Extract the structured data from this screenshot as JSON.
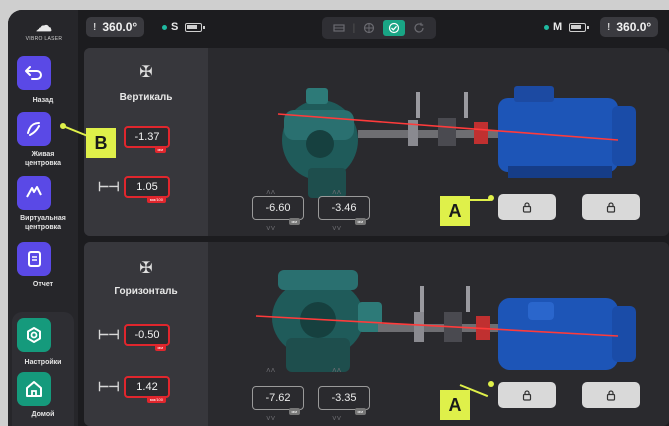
{
  "sidebar": {
    "logo_text": "VIBRO LASER",
    "items": [
      {
        "label": "Назад",
        "icon": "back-arrow-icon"
      },
      {
        "label": "Живая центровка",
        "icon": "live-alignment-icon"
      },
      {
        "label": "Виртуальная центровка",
        "icon": "virtual-alignment-icon"
      },
      {
        "label": "Отчет",
        "icon": "report-icon"
      },
      {
        "label": "Настройки",
        "icon": "settings-icon"
      },
      {
        "label": "Домой",
        "icon": "home-icon"
      }
    ]
  },
  "topbar": {
    "left_angle": "360.0°",
    "left_unit": "S",
    "right_unit": "M",
    "right_angle": "360.0°",
    "modes": [
      "horizontal-mode-icon",
      "target-mode-icon",
      "check-mode-icon",
      "refresh-mode-icon"
    ]
  },
  "vertical": {
    "title": "Вертикаль",
    "offset_value": "-1.37",
    "offset_unit": "мм",
    "angle_value": "1.05",
    "angle_unit": "мм/100",
    "foot1_value": "-6.60",
    "foot2_value": "-3.46",
    "foot_unit": "мм"
  },
  "horizontal": {
    "title": "Горизонталь",
    "offset_value": "-0.50",
    "offset_unit": "мм",
    "angle_value": "1.42",
    "angle_unit": "мм/100",
    "foot1_value": "-7.62",
    "foot2_value": "-3.35",
    "foot_unit": "мм"
  },
  "callouts": {
    "a": "A",
    "b": "B"
  },
  "colors": {
    "accent": "#5a49e6",
    "green": "#19a585",
    "alert": "#e0262d",
    "callout": "#dff04a"
  }
}
